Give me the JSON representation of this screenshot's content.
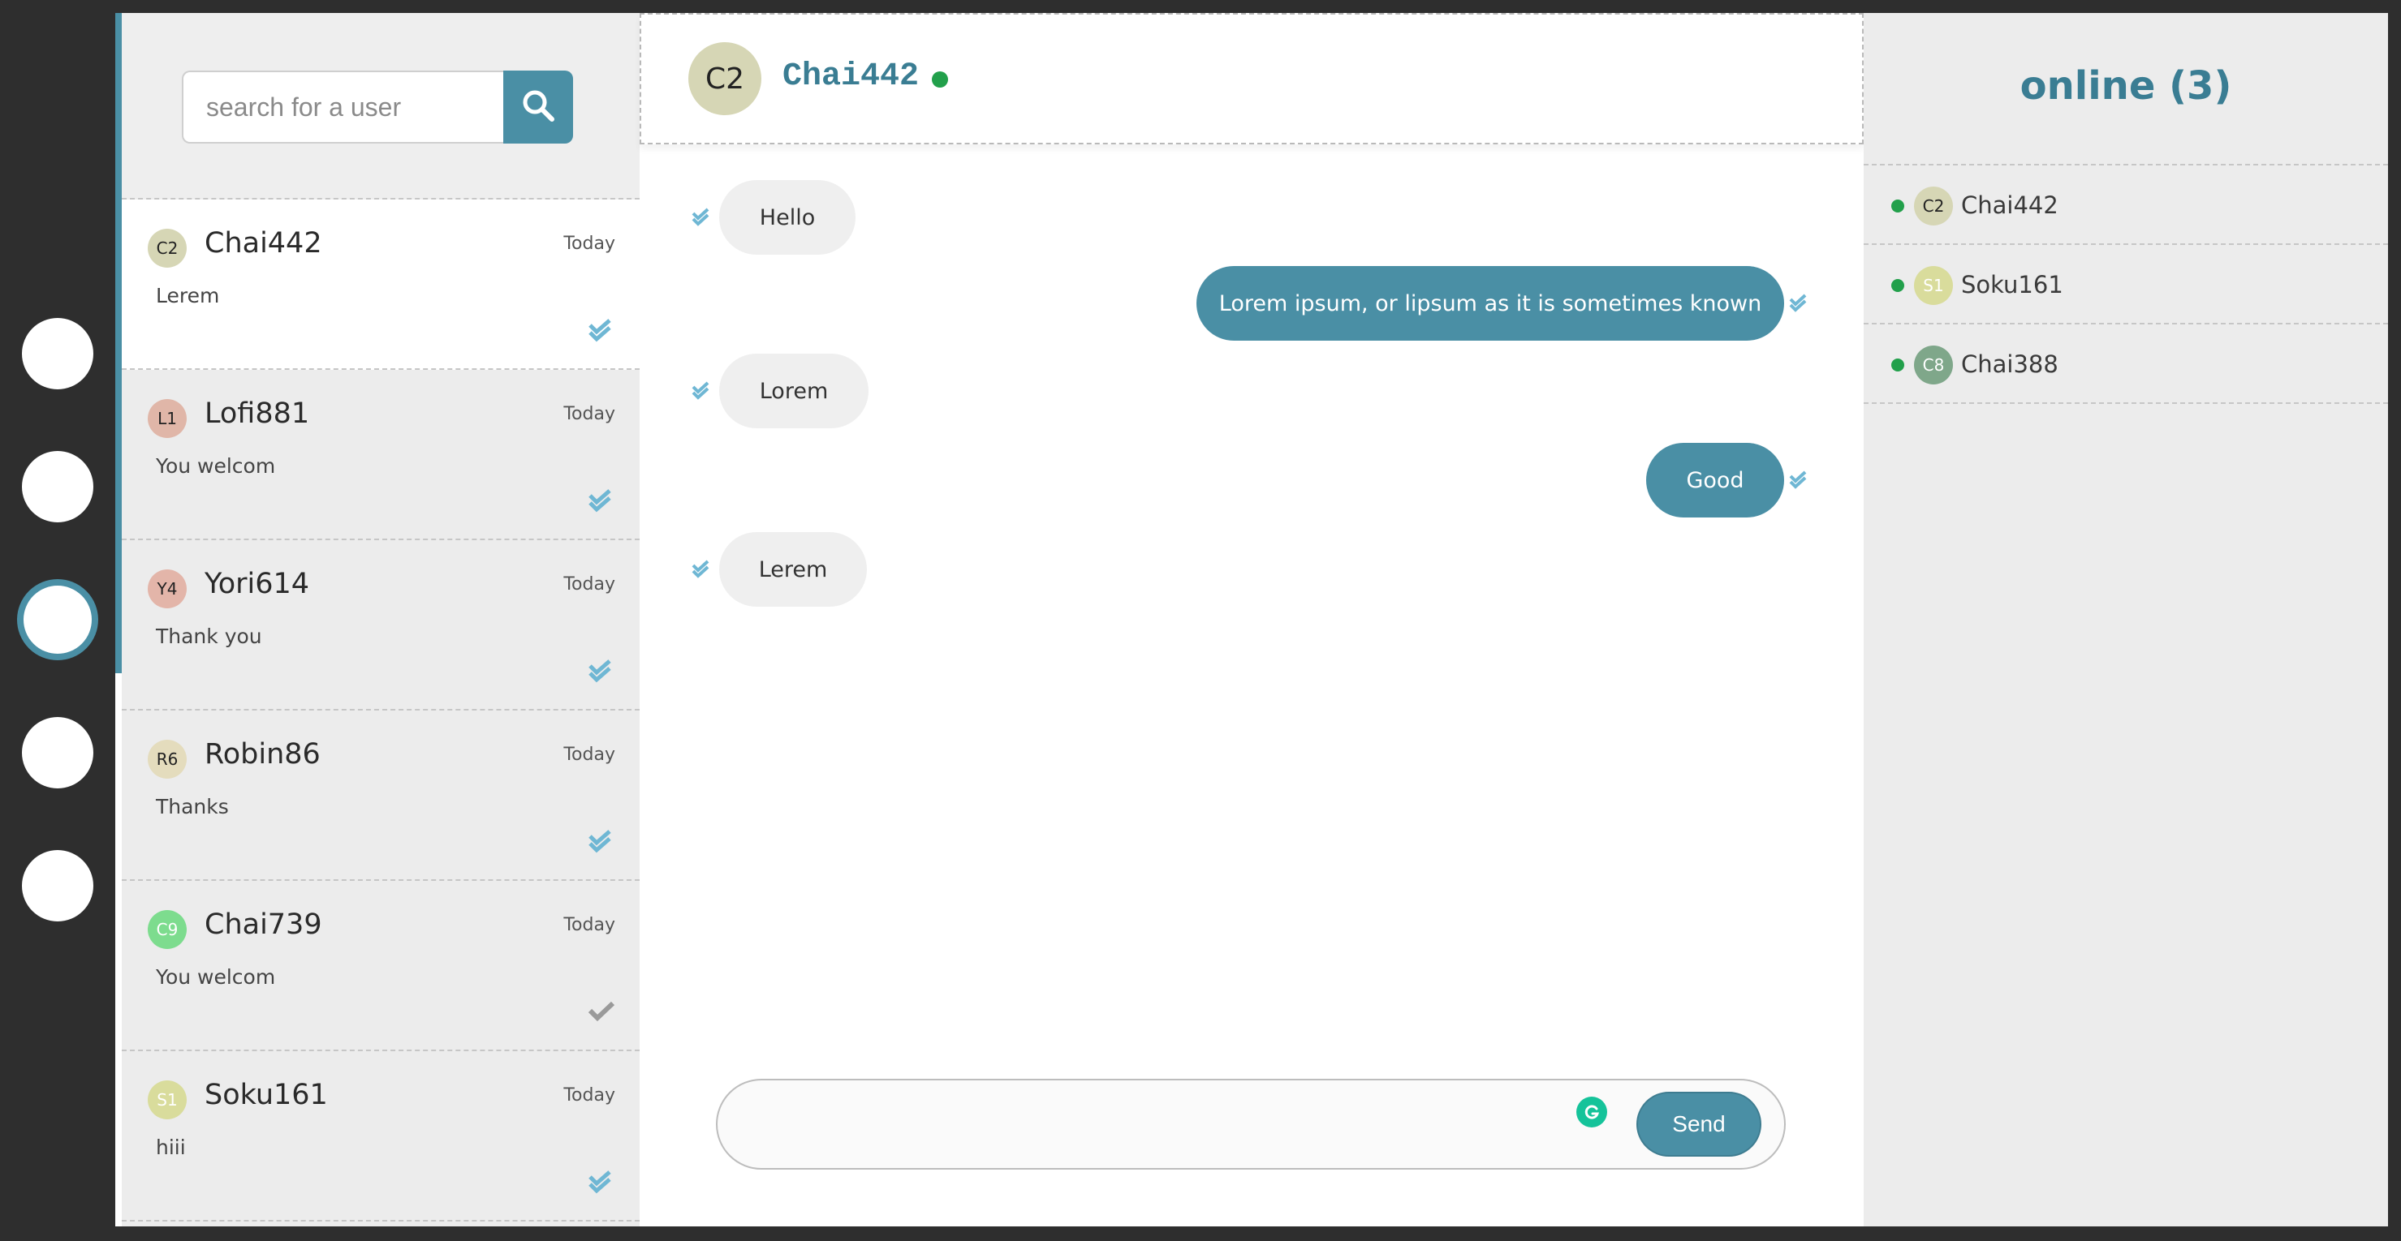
{
  "search": {
    "placeholder": "search for a user"
  },
  "conversations": [
    {
      "initials": "C2",
      "name": "Chai442",
      "time": "Today",
      "preview": "Lerem",
      "status": "read",
      "avatar_bg": "#d6d6b5",
      "avatar_fg": "#222222",
      "active": true
    },
    {
      "initials": "L1",
      "name": "Lofi881",
      "time": "Today",
      "preview": "You welcom",
      "status": "read",
      "avatar_bg": "#e0b6a8",
      "avatar_fg": "#222222"
    },
    {
      "initials": "Y4",
      "name": "Yori614",
      "time": "Today",
      "preview": "Thank you",
      "status": "read",
      "avatar_bg": "#e3b5a9",
      "avatar_fg": "#222222"
    },
    {
      "initials": "R6",
      "name": "Robin86",
      "time": "Today",
      "preview": "Thanks",
      "status": "read",
      "avatar_bg": "#e4dcbd",
      "avatar_fg": "#222222"
    },
    {
      "initials": "C9",
      "name": "Chai739",
      "time": "Today",
      "preview": "You welcom",
      "status": "sent",
      "avatar_bg": "#7ddc8e",
      "avatar_fg": "#ffffff"
    },
    {
      "initials": "S1",
      "name": "Soku161",
      "time": "Today",
      "preview": "hiii",
      "status": "read",
      "avatar_bg": "#d9dc9c",
      "avatar_fg": "#ffffff"
    }
  ],
  "chat": {
    "initials": "C2",
    "name": "Chai442",
    "messages": [
      {
        "text": "Hello",
        "direction": "in"
      },
      {
        "text": "Lorem ipsum, or lipsum as it is sometimes known",
        "direction": "out"
      },
      {
        "text": "Lorem",
        "direction": "in"
      },
      {
        "text": "Good",
        "direction": "out"
      },
      {
        "text": "Lerem",
        "direction": "in"
      }
    ],
    "composer": {
      "value": "",
      "send_label": "Send"
    }
  },
  "online": {
    "title": "online (3)",
    "users": [
      {
        "initials": "C2",
        "name": "Chai442",
        "avatar_bg": "#d6d6b5",
        "avatar_fg": "#222222"
      },
      {
        "initials": "S1",
        "name": "Soku161",
        "avatar_bg": "#d9dc9c",
        "avatar_fg": "#ffffff"
      },
      {
        "initials": "C8",
        "name": "Chai388",
        "avatar_bg": "#7fa78a",
        "avatar_fg": "#ffffff"
      }
    ]
  },
  "colors": {
    "accent": "#4a8fa5",
    "accent_text": "#3a7d93",
    "online": "#22a04b",
    "read_tick": "#6fb7d4",
    "sent_tick": "#9a9a9a"
  },
  "icons": {
    "search": "search-icon",
    "read": "double-check-icon",
    "sent": "check-icon",
    "grammarly": "grammarly-icon"
  }
}
